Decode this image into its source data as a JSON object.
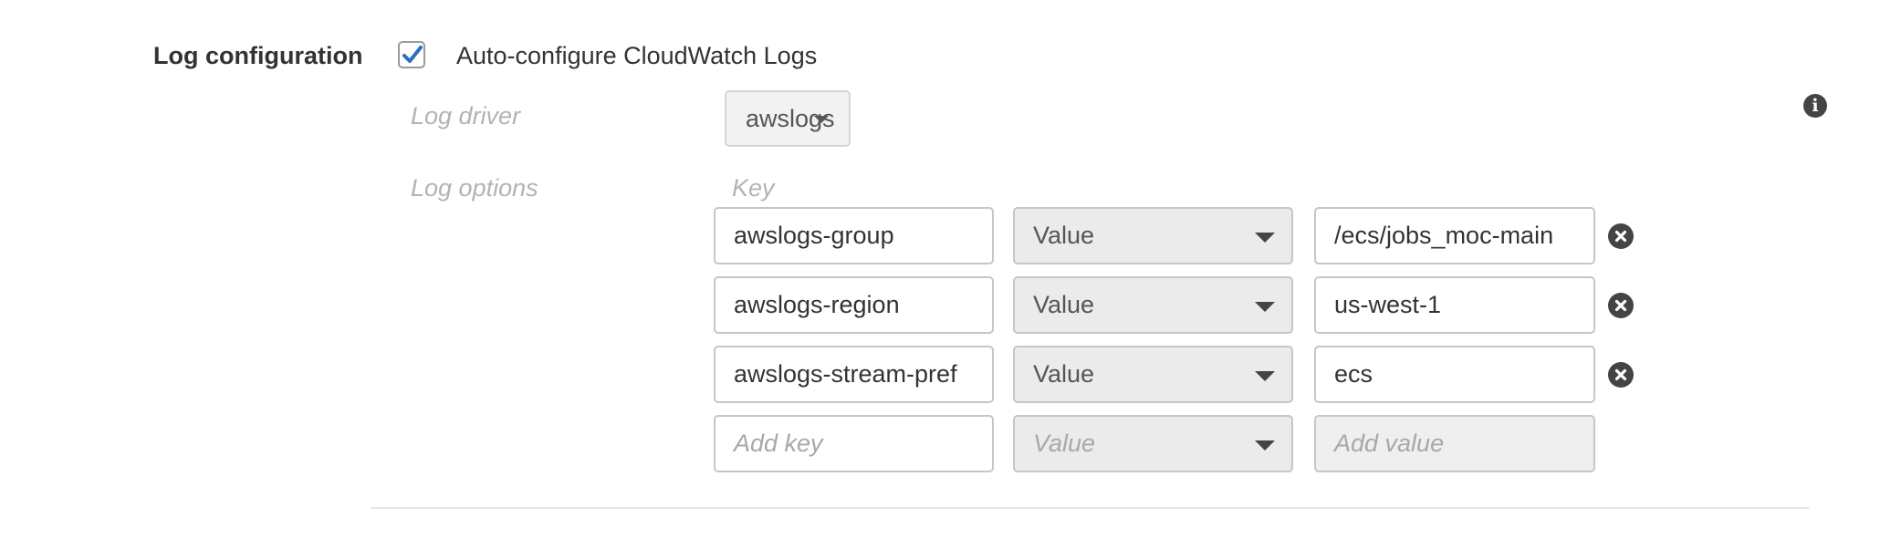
{
  "section": {
    "title": "Log configuration",
    "auto_configure": {
      "label": "Auto-configure CloudWatch Logs",
      "checked": true
    }
  },
  "log_driver": {
    "label": "Log driver",
    "value": "awslogs"
  },
  "log_options": {
    "label": "Log options",
    "key_header": "Key",
    "rows": [
      {
        "key": "awslogs-group",
        "type": "Value",
        "value": "/ecs/jobs_moc-main"
      },
      {
        "key": "awslogs-region",
        "type": "Value",
        "value": "us-west-1"
      },
      {
        "key": "awslogs-stream-pref",
        "type": "Value",
        "value": "ecs"
      }
    ],
    "new_row": {
      "key_placeholder": "Add key",
      "type": "Value",
      "value_placeholder": "Add value"
    }
  },
  "colors": {
    "checkbox_check": "#2a6ebd",
    "icon_dark": "#444444"
  },
  "icons": {
    "info": "info-icon",
    "remove": "remove-icon",
    "checkbox": "checkmark-icon"
  }
}
